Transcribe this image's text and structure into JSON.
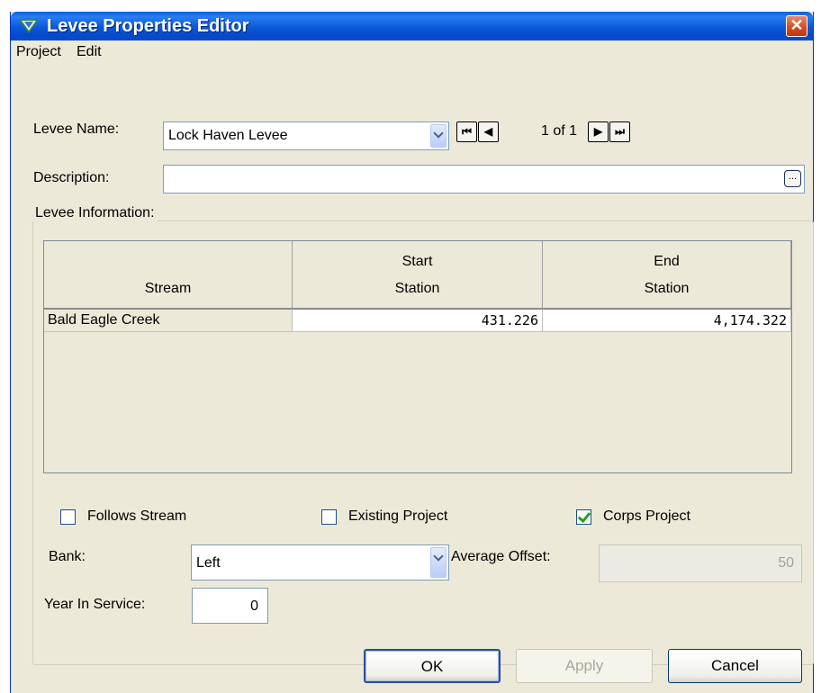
{
  "window": {
    "title": "Levee Properties Editor",
    "close_glyph": "✕"
  },
  "menu": {
    "items": [
      "Project",
      "Edit"
    ]
  },
  "levee_name": {
    "label": "Levee Name:",
    "value": "Lock Haven Levee"
  },
  "navigator": {
    "first": "⏮",
    "prev": "◀",
    "count": "1 of 1",
    "next": "▶",
    "last": "⏭"
  },
  "description": {
    "label": "Description:",
    "value": "",
    "ellipsis": "..."
  },
  "levee_info": {
    "title": "Levee Information:",
    "columns": [
      {
        "line1": "",
        "line2": "Stream"
      },
      {
        "line1": "Start",
        "line2": "Station"
      },
      {
        "line1": "End",
        "line2": "Station"
      }
    ],
    "rows": [
      {
        "stream": "Bald Eagle Creek",
        "start_station": "431.226",
        "end_station": "4,174.322"
      }
    ]
  },
  "checkboxes": {
    "follows_stream": {
      "label": "Follows Stream",
      "checked": false
    },
    "existing_project": {
      "label": "Existing Project",
      "checked": false
    },
    "corps_project": {
      "label": "Corps Project",
      "checked": true
    }
  },
  "bank": {
    "label": "Bank:",
    "value": "Left"
  },
  "average_offset": {
    "label": "Average Offset:",
    "value": "50"
  },
  "year_in_service": {
    "label": "Year In Service:",
    "value": "0"
  },
  "buttons": {
    "ok": "OK",
    "apply": "Apply",
    "cancel": "Cancel"
  },
  "colors": {
    "titlebar": "#0a5fdc",
    "dialog_bg": "#ece9d8",
    "checkmark": "#21a121"
  },
  "icons": [
    "app-icon",
    "close-icon",
    "dropdown-arrow-icon",
    "first-record-icon",
    "previous-record-icon",
    "next-record-icon",
    "last-record-icon",
    "ellipsis-icon",
    "checkmark-icon"
  ]
}
